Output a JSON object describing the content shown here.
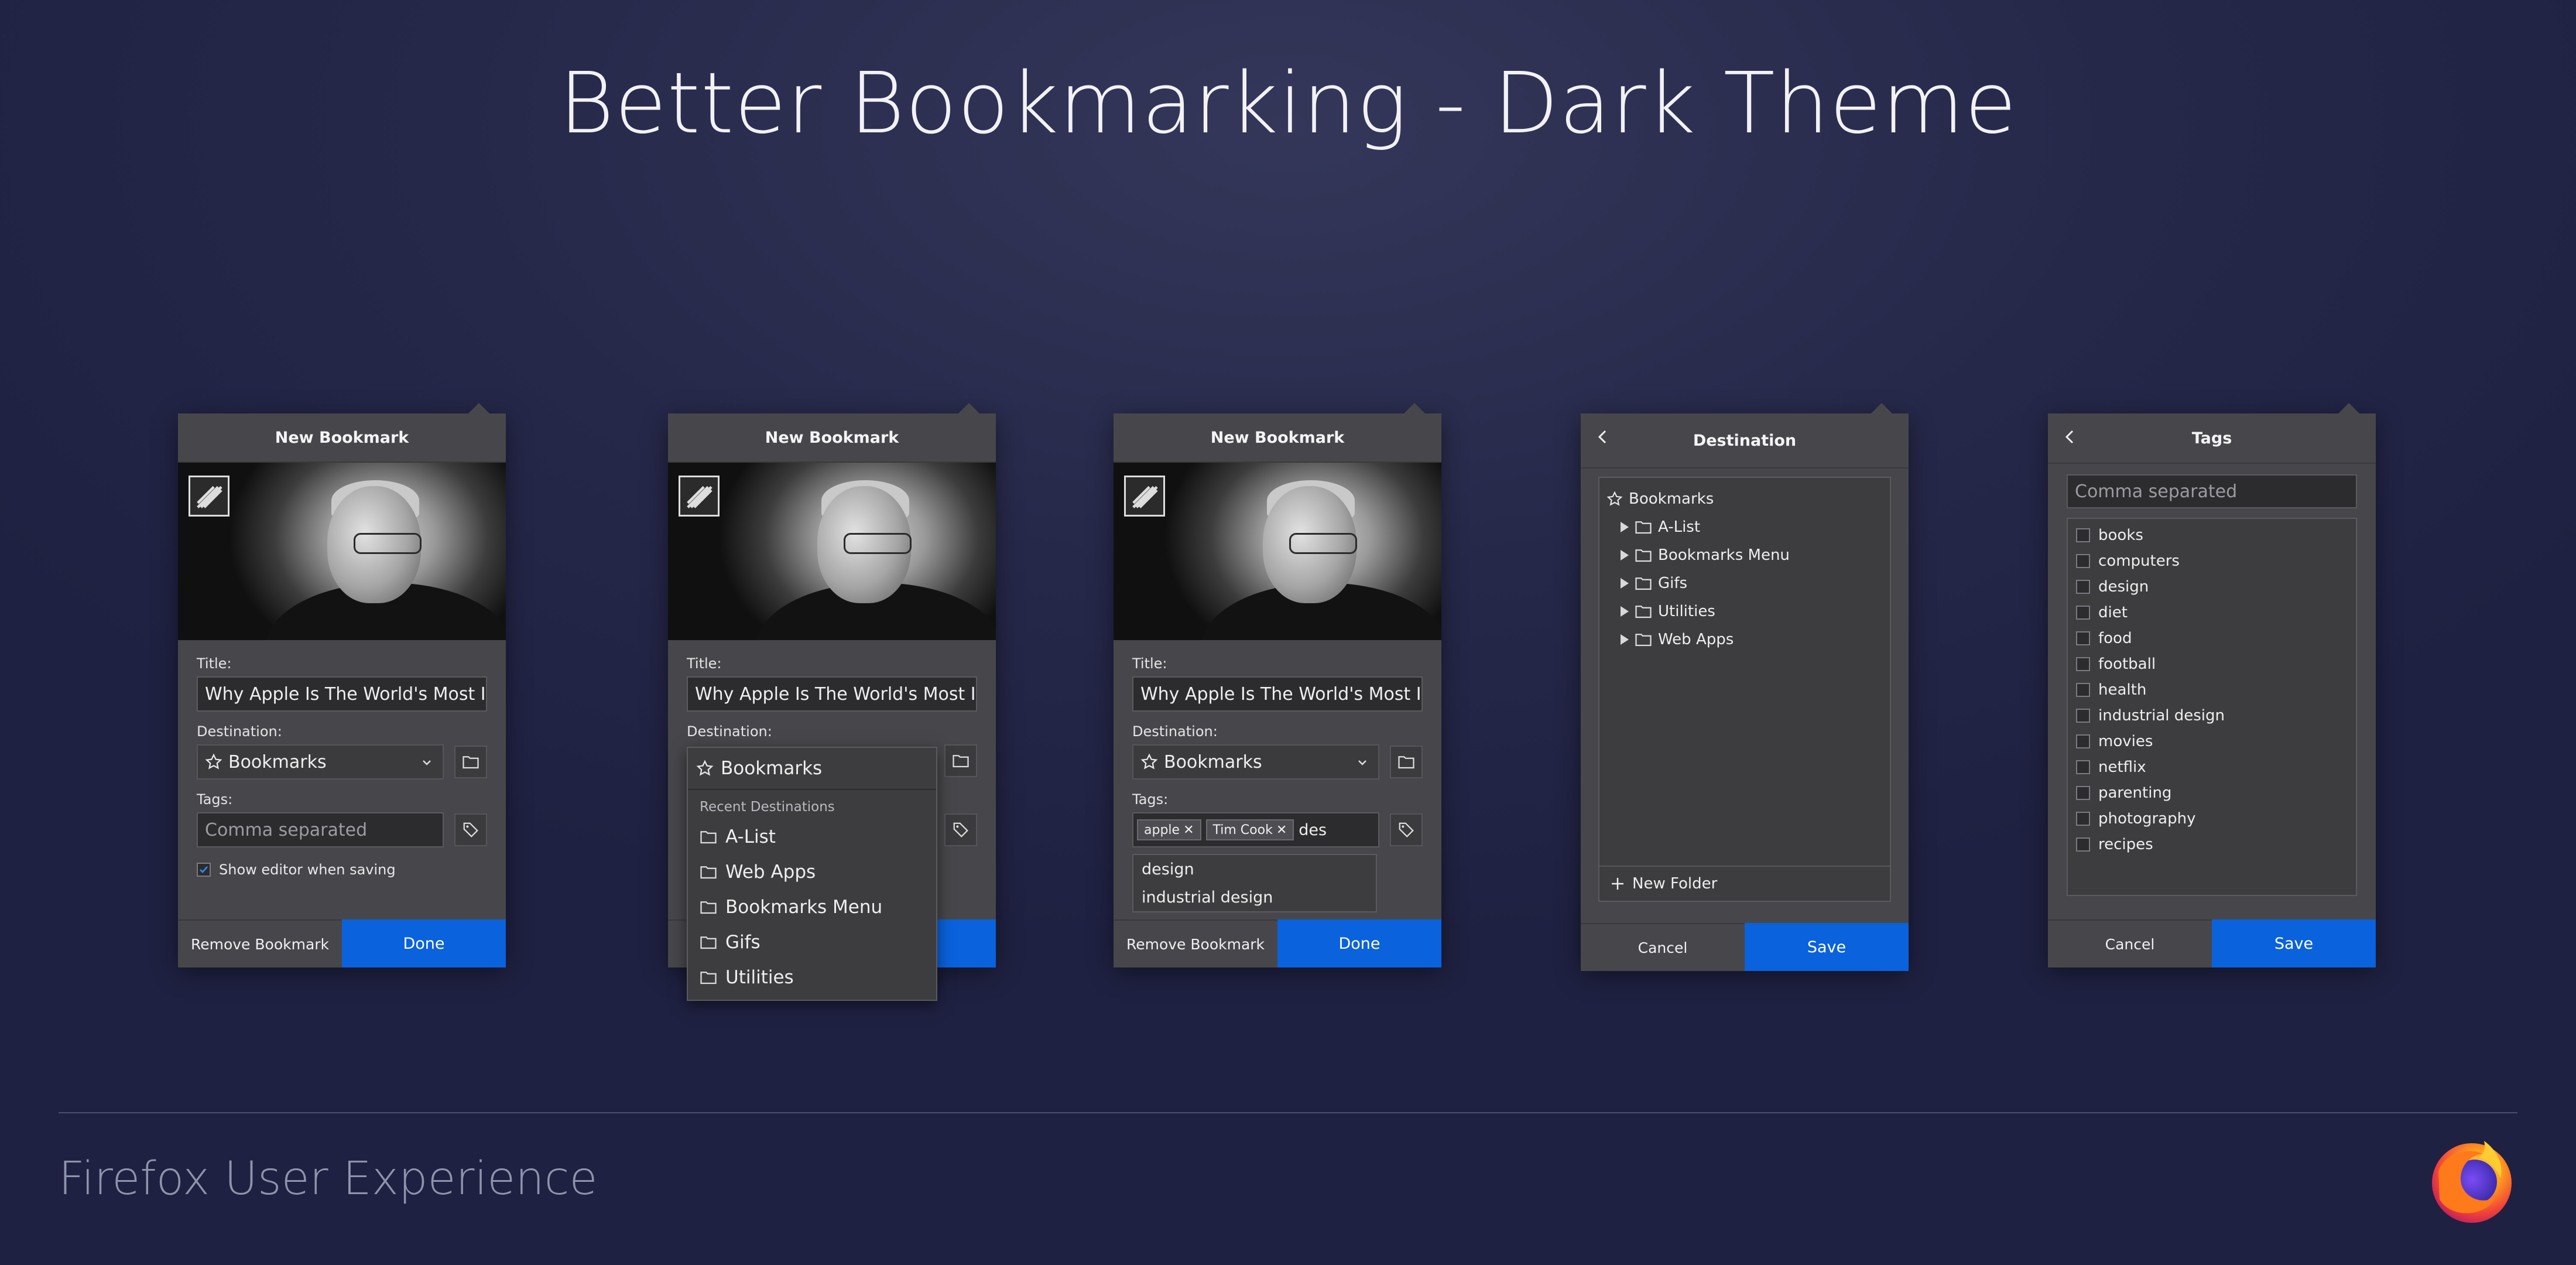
{
  "headline": "Better Bookmarking - Dark Theme",
  "footer": "Firefox User Experience",
  "colors": {
    "accent": "#0a62dc",
    "panel": "#47474b",
    "field": "#2c2c2f"
  },
  "panel1": {
    "title": "New Bookmark",
    "title_label": "Title:",
    "title_value": "Why Apple Is The World's Most Innovative Company",
    "destination_label": "Destination:",
    "destination_value": "Bookmarks",
    "tags_label": "Tags:",
    "tags_placeholder": "Comma separated",
    "show_editor": "Show editor when saving",
    "show_editor_checked": true,
    "remove": "Remove Bookmark",
    "done": "Done"
  },
  "panel2": {
    "title": "New Bookmark",
    "title_label": "Title:",
    "title_value": "Why Apple Is The World's Most Innovative Company",
    "destination_label": "Destination:",
    "dropdown": {
      "selected": "Bookmarks",
      "section": "Recent Destinations",
      "items": [
        "A-List",
        "Web Apps",
        "Bookmarks Menu",
        "Gifs",
        "Utilities"
      ]
    }
  },
  "panel3": {
    "title": "New Bookmark",
    "title_label": "Title:",
    "title_value": "Why Apple Is The World's Most Innovative Company",
    "destination_label": "Destination:",
    "destination_value": "Bookmarks",
    "tags_label": "Tags:",
    "chips": [
      "apple",
      "Tim Cook"
    ],
    "typed": "des",
    "suggestions": [
      "design",
      "industrial design"
    ],
    "remove": "Remove Bookmark",
    "done": "Done"
  },
  "panel4": {
    "title": "Destination",
    "root": "Bookmarks",
    "folders": [
      "A-List",
      "Bookmarks Menu",
      "Gifs",
      "Utilities",
      "Web Apps"
    ],
    "new_folder": "New Folder",
    "cancel": "Cancel",
    "save": "Save"
  },
  "panel5": {
    "title": "Tags",
    "placeholder": "Comma separated",
    "tags": [
      "books",
      "computers",
      "design",
      "diet",
      "food",
      "football",
      "health",
      "industrial design",
      "movies",
      "netflix",
      "parenting",
      "photography",
      "recipes"
    ],
    "cancel": "Cancel",
    "save": "Save"
  }
}
